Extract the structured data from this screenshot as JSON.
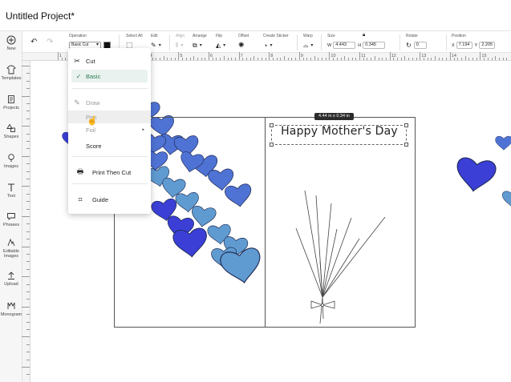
{
  "app": {
    "project_title": "Untitled Project*"
  },
  "sidebar": {
    "items": [
      {
        "label": "New",
        "icon": "plus-circle-icon"
      },
      {
        "label": "Templates",
        "icon": "shirt-icon"
      },
      {
        "label": "Projects",
        "icon": "projects-icon"
      },
      {
        "label": "Shapes",
        "icon": "shapes-icon"
      },
      {
        "label": "Images",
        "icon": "lightbulb-icon"
      },
      {
        "label": "Text",
        "icon": "text-icon"
      },
      {
        "label": "Phrases",
        "icon": "speech-bubble-icon"
      },
      {
        "label": "Editable Images",
        "icon": "editable-images-icon"
      },
      {
        "label": "Upload",
        "icon": "upload-icon"
      },
      {
        "label": "Monogram",
        "icon": "monogram-icon"
      }
    ]
  },
  "toolbar": {
    "operation_label": "Operation",
    "operation_value": "Basic Cut",
    "select_all_label": "Select All",
    "edit_label": "Edit",
    "align_label": "Align",
    "arrange_label": "Arrange",
    "flip_label": "Flip",
    "offset_label": "Offset",
    "create_sticker_label": "Create Sticker",
    "warp_label": "Warp",
    "size_label": "Size",
    "size_w_letter": "W",
    "size_w_value": "4.443",
    "size_h_letter": "H",
    "size_h_value": "0.345",
    "rotate_label": "Rotate",
    "rotate_value": "0",
    "position_label": "Position",
    "position_x_letter": "X",
    "position_x_value": "7.194",
    "position_y_letter": "Y",
    "position_y_value": "2.205",
    "swatch_color": "#111111"
  },
  "ruler": {
    "top_numbers": [
      "1",
      "2",
      "3",
      "4",
      "5",
      "6",
      "7",
      "8",
      "9",
      "10",
      "11",
      "12",
      "13",
      "14",
      "15"
    ]
  },
  "menu": {
    "items": [
      {
        "label": "Cut",
        "icon": "scissors-icon",
        "state": "normal"
      },
      {
        "label": "Basic",
        "icon": "check-icon",
        "state": "selected"
      },
      {
        "label": "Draw",
        "icon": "pen-icon",
        "state": "muted"
      },
      {
        "label": "Pen",
        "icon": "",
        "state": "hover"
      },
      {
        "label": "Foil",
        "icon": "",
        "state": "muted"
      },
      {
        "label": "Score",
        "icon": "",
        "state": "normal"
      },
      {
        "label": "Print Then Cut",
        "icon": "printer-icon",
        "state": "normal"
      },
      {
        "label": "Guide",
        "icon": "guide-icon",
        "state": "normal"
      }
    ]
  },
  "canvas": {
    "size_tooltip": "4.44 in x 0.34 in",
    "card_text": "Happy Mother's Day",
    "colors": {
      "heart_dark": "#3b3fd6",
      "heart_mid": "#4f73d4",
      "heart_light": "#5f9bd0"
    }
  }
}
